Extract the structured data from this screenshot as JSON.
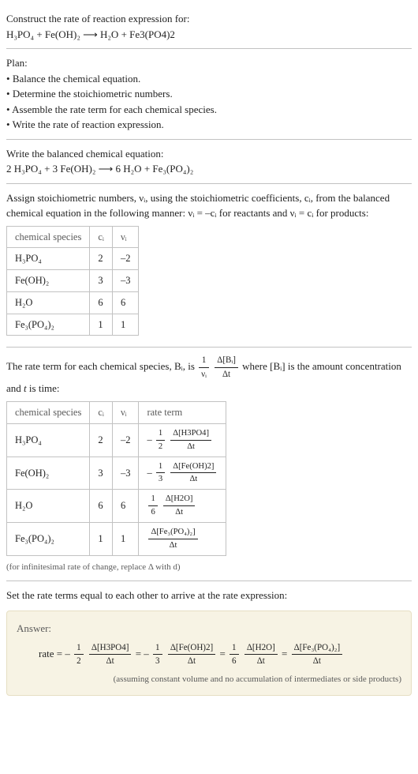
{
  "header": {
    "prompt": "Construct the rate of reaction expression for:",
    "equation": "H₃PO₄ + Fe(OH)₂ ⟶ H₂O + Fe3(PO4)2"
  },
  "plan": {
    "title": "Plan:",
    "items": [
      "Balance the chemical equation.",
      "Determine the stoichiometric numbers.",
      "Assemble the rate term for each chemical species.",
      "Write the rate of reaction expression."
    ]
  },
  "balanced": {
    "title": "Write the balanced chemical equation:",
    "equation": "2 H₃PO₄ + 3 Fe(OH)₂ ⟶ 6 H₂O + Fe₃(PO₄)₂"
  },
  "assign": {
    "text_a": "Assign stoichiometric numbers, νᵢ, using the stoichiometric coefficients, cᵢ, from the balanced chemical equation in the following manner: νᵢ = –cᵢ for reactants and νᵢ = cᵢ for products:",
    "cols": {
      "a": "chemical species",
      "b": "cᵢ",
      "c": "νᵢ"
    },
    "rows": [
      {
        "sp": "H₃PO₄",
        "c": "2",
        "v": "–2"
      },
      {
        "sp": "Fe(OH)₂",
        "c": "3",
        "v": "–3"
      },
      {
        "sp": "H₂O",
        "c": "6",
        "v": "6"
      },
      {
        "sp": "Fe₃(PO₄)₂",
        "c": "1",
        "v": "1"
      }
    ]
  },
  "rateterm": {
    "intro_a": "The rate term for each chemical species, Bᵢ, is ",
    "intro_b": " where [Bᵢ] is the amount concentration and ",
    "intro_c": " is time:",
    "t": "t",
    "f1n": "1",
    "f1d": "νᵢ",
    "f2n": "Δ[Bᵢ]",
    "f2d": "Δt",
    "cols": {
      "a": "chemical species",
      "b": "cᵢ",
      "c": "νᵢ",
      "d": "rate term"
    },
    "rows": [
      {
        "sp": "H₃PO₄",
        "c": "2",
        "v": "–2",
        "pre": "– ",
        "fn": "1",
        "fd": "2",
        "gn": "Δ[H3PO4]",
        "gd": "Δt"
      },
      {
        "sp": "Fe(OH)₂",
        "c": "3",
        "v": "–3",
        "pre": "– ",
        "fn": "1",
        "fd": "3",
        "gn": "Δ[Fe(OH)2]",
        "gd": "Δt"
      },
      {
        "sp": "H₂O",
        "c": "6",
        "v": "6",
        "pre": "",
        "fn": "1",
        "fd": "6",
        "gn": "Δ[H2O]",
        "gd": "Δt"
      },
      {
        "sp": "Fe₃(PO₄)₂",
        "c": "1",
        "v": "1",
        "pre": "",
        "fn": "",
        "fd": "",
        "gn": "Δ[Fe₃(PO₄)₂]",
        "gd": "Δt"
      }
    ],
    "footnote": "(for infinitesimal rate of change, replace Δ with d)"
  },
  "setline": "Set the rate terms equal to each other to arrive at the rate expression:",
  "answer": {
    "label": "Answer:",
    "lead": "rate = – ",
    "t1a": "1",
    "t1b": "2",
    "t1c": "Δ[H3PO4]",
    "t1d": "Δt",
    "eq1": " = – ",
    "t2a": "1",
    "t2b": "3",
    "t2c": "Δ[Fe(OH)2]",
    "t2d": "Δt",
    "eq2": " = ",
    "t3a": "1",
    "t3b": "6",
    "t3c": "Δ[H2O]",
    "t3d": "Δt",
    "eq3": " = ",
    "t4c": "Δ[Fe₃(PO₄)₂]",
    "t4d": "Δt",
    "footnote": "(assuming constant volume and no accumulation of intermediates or side products)"
  }
}
